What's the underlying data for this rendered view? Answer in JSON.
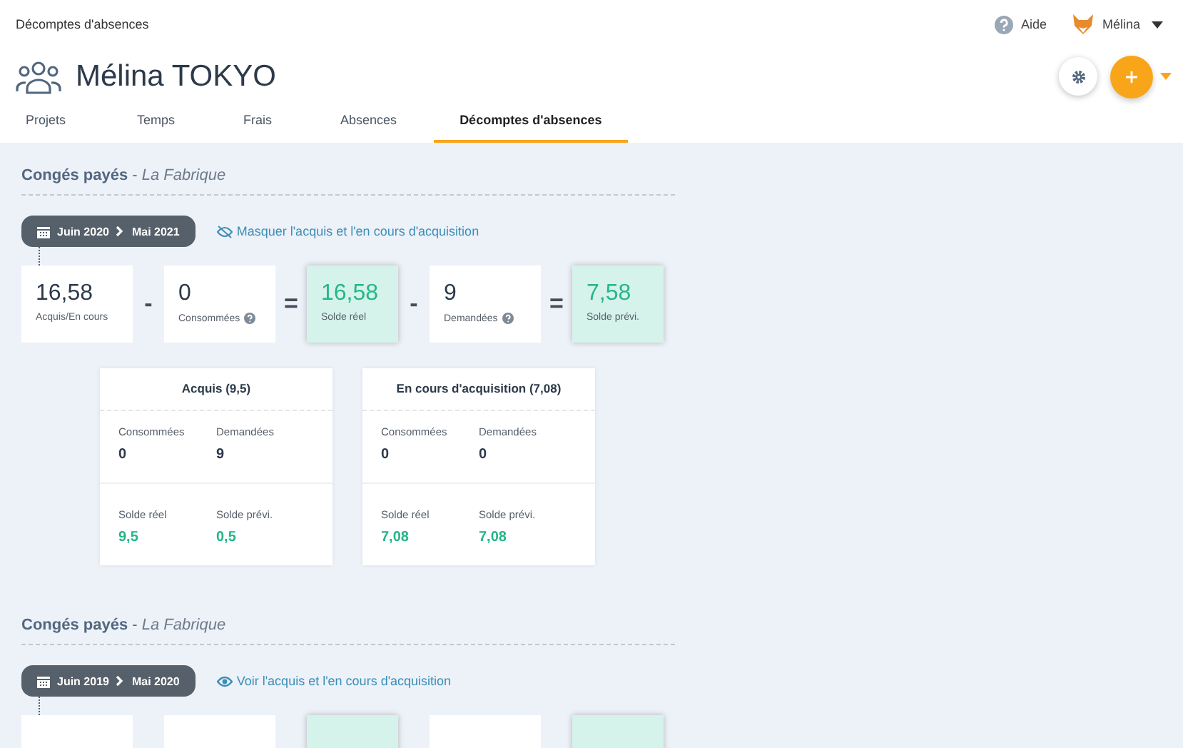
{
  "breadcrumb": "Décomptes d'absences",
  "header_links": {
    "help": "Aide",
    "user": "Mélina"
  },
  "title": "Mélina TOKYO",
  "tabs": [
    {
      "label": "Projets",
      "selected": false
    },
    {
      "label": "Temps",
      "selected": false
    },
    {
      "label": "Frais",
      "selected": false
    },
    {
      "label": "Absences",
      "selected": false
    },
    {
      "label": "Décomptes d'absences",
      "selected": true
    }
  ],
  "sections": [
    {
      "title": "Congés payés",
      "separator": "-",
      "company": "La Fabrique",
      "period_start": "Juin 2020",
      "period_end": "Mai 2021",
      "toggle": {
        "kind": "hide",
        "label": "Masquer l'acquis et l'en cours d'acquisition"
      },
      "tiles": [
        {
          "kind": "plain",
          "value": "16,58",
          "label": "Acquis/En cours",
          "help": false
        },
        {
          "kind": "operator",
          "value": "-"
        },
        {
          "kind": "plain",
          "value": "0",
          "label": "Consommées",
          "help": true
        },
        {
          "kind": "operator",
          "value": "="
        },
        {
          "kind": "balance",
          "value": "16,58",
          "label": "Solde réel",
          "help": false
        },
        {
          "kind": "operator",
          "value": "-"
        },
        {
          "kind": "plain",
          "value": "9",
          "label": "Demandées",
          "help": true
        },
        {
          "kind": "operator",
          "value": "="
        },
        {
          "kind": "balance",
          "value": "7,58",
          "label": "Solde prévi.",
          "help": false
        }
      ],
      "details": [
        {
          "title": "Acquis (9,5)",
          "rows": [
            [
              {
                "label": "Consommées",
                "value": "0"
              },
              {
                "label": "Demandées",
                "value": "9"
              }
            ],
            [
              {
                "label": "Solde réel",
                "value": "9,5"
              },
              {
                "label": "Solde prévi.",
                "value": "0,5"
              }
            ]
          ]
        },
        {
          "title": "En cours d'acquisition (7,08)",
          "rows": [
            [
              {
                "label": "Consommées",
                "value": "0"
              },
              {
                "label": "Demandées",
                "value": "0"
              }
            ],
            [
              {
                "label": "Solde réel",
                "value": "7,08"
              },
              {
                "label": "Solde prévi.",
                "value": "7,08"
              }
            ]
          ]
        }
      ]
    },
    {
      "title": "Congés payés",
      "separator": "-",
      "company": "La Fabrique",
      "period_start": "Juin 2019",
      "period_end": "Mai 2020",
      "toggle": {
        "kind": "show",
        "label": "Voir l'acquis et l'en cours d'acquisition"
      },
      "tiles": [
        {
          "kind": "plain"
        },
        {
          "kind": "operator"
        },
        {
          "kind": "plain"
        },
        {
          "kind": "operator"
        },
        {
          "kind": "balance"
        },
        {
          "kind": "operator"
        },
        {
          "kind": "plain"
        },
        {
          "kind": "operator"
        },
        {
          "kind": "balance"
        }
      ]
    }
  ]
}
